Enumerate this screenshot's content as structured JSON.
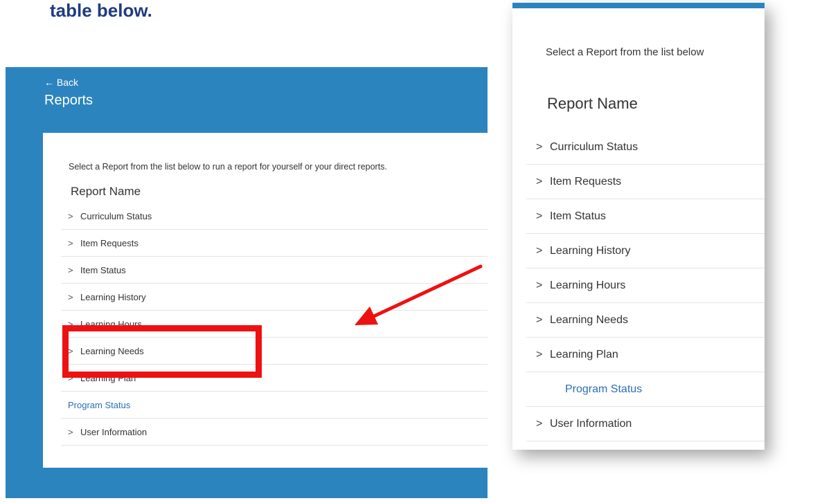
{
  "heading_fragment": "table below.",
  "left": {
    "back_label": "← Back",
    "title": "Reports",
    "instructions": "Select a Report from the list below to run a report for yourself or your direct reports.",
    "column_header": "Report Name",
    "items": [
      {
        "label": "Curriculum Status",
        "type": "expandable"
      },
      {
        "label": "Item Requests",
        "type": "expandable"
      },
      {
        "label": "Item Status",
        "type": "expandable"
      },
      {
        "label": "Learning History",
        "type": "expandable"
      },
      {
        "label": "Learning Hours",
        "type": "expandable"
      },
      {
        "label": "Learning Needs",
        "type": "expandable"
      },
      {
        "label": "Learning Plan",
        "type": "expandable"
      },
      {
        "label": "Program Status",
        "type": "link"
      },
      {
        "label": "User Information",
        "type": "expandable"
      }
    ]
  },
  "right": {
    "instructions": "Select a Report from the list below",
    "column_header": "Report Name",
    "items": [
      {
        "label": "Curriculum Status",
        "type": "expandable"
      },
      {
        "label": "Item Requests",
        "type": "expandable"
      },
      {
        "label": "Item Status",
        "type": "expandable"
      },
      {
        "label": "Learning History",
        "type": "expandable"
      },
      {
        "label": "Learning Hours",
        "type": "expandable"
      },
      {
        "label": "Learning Needs",
        "type": "expandable"
      },
      {
        "label": "Learning Plan",
        "type": "expandable"
      },
      {
        "label": "Program Status",
        "type": "link"
      },
      {
        "label": "User Information",
        "type": "expandable"
      }
    ]
  },
  "colors": {
    "header_blue": "#2c84be",
    "link_blue": "#2a6fb3",
    "highlight_red": "#ee1111",
    "heading_navy": "#1f3b82"
  },
  "icons": {
    "chevron": "chevron-right-icon",
    "arrow": "arrow-icon"
  }
}
